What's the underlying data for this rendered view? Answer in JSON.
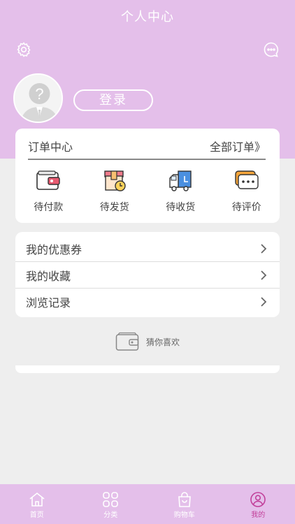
{
  "header": {
    "title": "个人中心"
  },
  "icons": {
    "settings": "gear-icon",
    "message": "chat-bubble-icon"
  },
  "profile": {
    "login_label": "登录"
  },
  "orders": {
    "title": "订单中心",
    "all_link": "全部订单》",
    "items": [
      {
        "label": "待付款",
        "icon": "wallet-icon"
      },
      {
        "label": "待发货",
        "icon": "box-clock-icon"
      },
      {
        "label": "待收货",
        "icon": "truck-icon"
      },
      {
        "label": "待评价",
        "icon": "comment-icon"
      }
    ]
  },
  "menu": {
    "items": [
      {
        "label": "我的优惠券"
      },
      {
        "label": "我的收藏"
      },
      {
        "label": "浏览记录"
      }
    ]
  },
  "guess": {
    "label": "猜你喜欢"
  },
  "tabbar": {
    "items": [
      {
        "label": "首页",
        "icon": "home-icon"
      },
      {
        "label": "分类",
        "icon": "grid-icon"
      },
      {
        "label": "购物车",
        "icon": "shopping-bag-icon"
      },
      {
        "label": "我的",
        "icon": "user-icon",
        "active": true
      }
    ]
  },
  "colors": {
    "header_bg": "#e4bfea",
    "active_tab": "#c2409a"
  }
}
